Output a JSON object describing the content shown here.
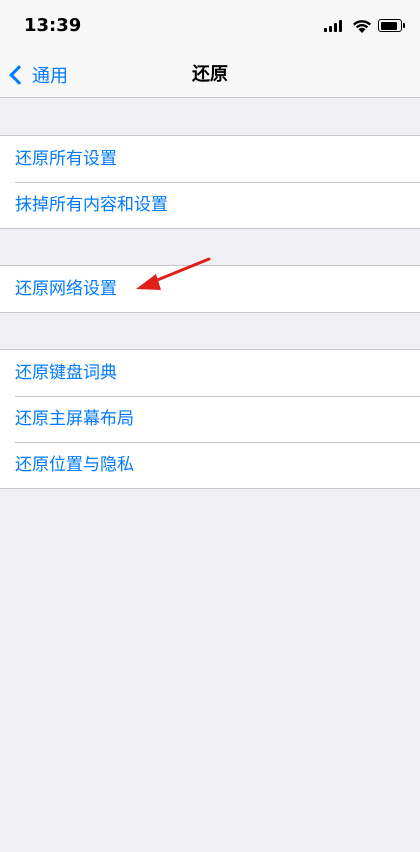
{
  "status_bar": {
    "time": "13:39"
  },
  "nav": {
    "back_label": "通用",
    "title": "还原"
  },
  "groups": [
    {
      "items": [
        {
          "label": "还原所有设置"
        },
        {
          "label": "抹掉所有内容和设置"
        }
      ]
    },
    {
      "items": [
        {
          "label": "还原网络设置"
        }
      ]
    },
    {
      "items": [
        {
          "label": "还原键盘词典"
        },
        {
          "label": "还原主屏幕布局"
        },
        {
          "label": "还原位置与隐私"
        }
      ]
    }
  ],
  "colors": {
    "accent": "#007aff",
    "background": "#efeff4",
    "annotation_arrow": "#e0201b"
  }
}
